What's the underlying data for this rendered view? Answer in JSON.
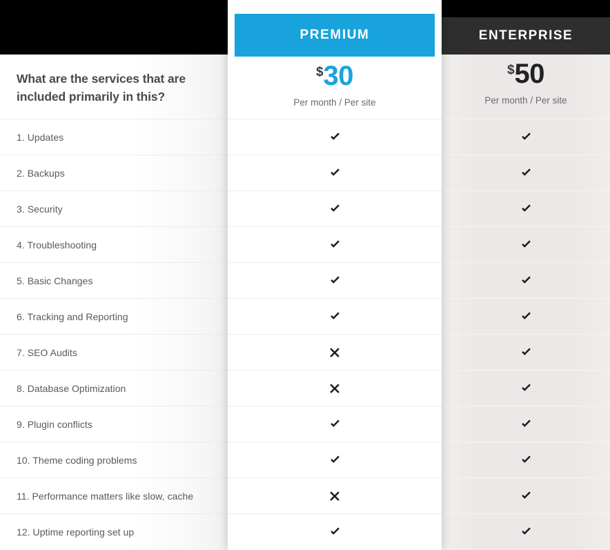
{
  "features_column": {
    "question": "What are the services that are included primarily in this?",
    "items": [
      "1. Updates",
      "2. Backups",
      "3. Security",
      "4. Troubleshooting",
      "5. Basic Changes",
      "6. Tracking and Reporting",
      "7. SEO Audits",
      "8. Database Optimization",
      "9. Plugin conflicts",
      "10. Theme coding problems",
      "11. Performance matters like slow, cache",
      "12. Uptime reporting set up"
    ]
  },
  "plans": [
    {
      "id": "premium",
      "name": "PREMIUM",
      "currency": "$",
      "price": "30",
      "period": "Per month / Per site",
      "accent_color": "#18a3dd",
      "featured": true,
      "marks": [
        "check-icon",
        "check-icon",
        "check-icon",
        "check-icon",
        "check-icon",
        "check-icon",
        "cross-icon",
        "cross-icon",
        "check-icon",
        "check-icon",
        "cross-icon",
        "check-icon"
      ]
    },
    {
      "id": "enterprise",
      "name": "ENTERPRISE",
      "currency": "$",
      "price": "50",
      "period": "Per month / Per site",
      "accent_color": "#2e2e2e",
      "featured": false,
      "marks": [
        "check-icon",
        "check-icon",
        "check-icon",
        "check-icon",
        "check-icon",
        "check-icon",
        "check-icon",
        "check-icon",
        "check-icon",
        "check-icon",
        "check-icon",
        "check-icon"
      ]
    }
  ]
}
